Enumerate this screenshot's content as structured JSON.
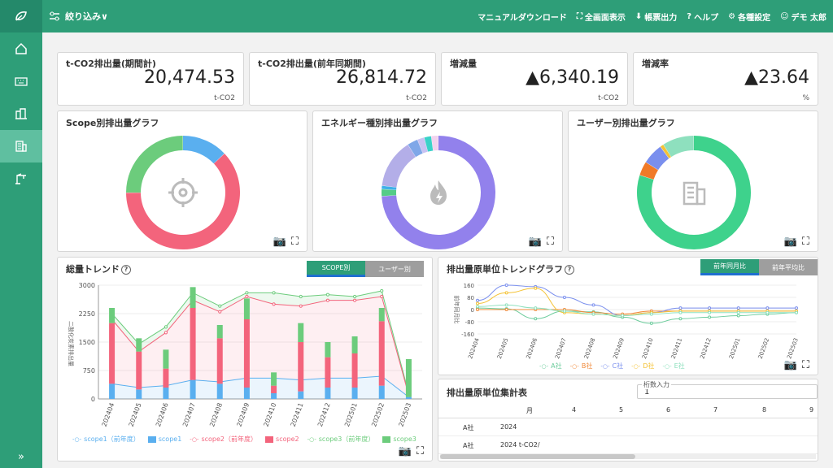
{
  "header": {
    "filter_label": "絞り込み∨",
    "items": [
      {
        "label": "マニュアルダウンロード",
        "icon": ""
      },
      {
        "label": "全画面表示",
        "icon": "⛶"
      },
      {
        "label": "帳票出力",
        "icon": "⬇"
      },
      {
        "label": "ヘルプ",
        "icon": "?"
      },
      {
        "label": "各種設定",
        "icon": "⚙"
      },
      {
        "label": "デモ 太郎",
        "icon": "☺"
      }
    ]
  },
  "kpis": [
    {
      "title": "t-CO2排出量(期間計)",
      "value": "20,474.53",
      "unit": "t-CO2"
    },
    {
      "title": "t-CO2排出量(前年同期間)",
      "value": "26,814.72",
      "unit": "t-CO2"
    },
    {
      "title": "増減量",
      "value": "▲6,340.19",
      "unit": "t-CO2"
    },
    {
      "title": "増減率",
      "value": "▲23.64",
      "unit": "%"
    }
  ],
  "donuts": [
    {
      "title": "Scope別排出量グラフ",
      "icon": "crosshair-icon"
    },
    {
      "title": "エネルギー種別排出量グラフ",
      "icon": "flame-icon"
    },
    {
      "title": "ユーザー別排出量グラフ",
      "icon": "building-icon"
    }
  ],
  "trend": {
    "title": "総量トレンド",
    "toggle_on": "SCOPE別",
    "toggle_off": "ユーザー別",
    "ylabel": "二酸化炭素排出量",
    "legend": [
      "scope1（前年度）",
      "scope1",
      "scope2（前年度）",
      "scope2",
      "scope3（前年度）",
      "scope3"
    ]
  },
  "intensity": {
    "title": "排出量原単位トレンドグラフ",
    "toggle_on": "前年同月比",
    "toggle_off": "前年平均比",
    "ylabel": "前年同月比",
    "legend": [
      "A社",
      "B社",
      "C社",
      "D社",
      "E社"
    ]
  },
  "table": {
    "title": "排出量原単位集計表",
    "input_label": "桁数入力",
    "input_value": "1",
    "headers": [
      "月",
      "4",
      "5",
      "6",
      "7",
      "8",
      "9"
    ],
    "rows": [
      {
        "company": "A社",
        "value": "2024"
      },
      {
        "company": "A社",
        "value": "2024  t-CO2/"
      }
    ]
  },
  "colors": {
    "brand": "#2e9e78",
    "scope1": "#5aafef",
    "scope2": "#f3647c",
    "scope3": "#6ccc7c",
    "energy": "#9281ec",
    "user": "#3ed28c"
  },
  "chart_data": [
    {
      "type": "pie",
      "title": "Scope別排出量グラフ",
      "series": [
        {
          "name": "scope1",
          "values": [
            0.13
          ]
        },
        {
          "name": "scope2",
          "values": [
            0.62
          ]
        },
        {
          "name": "scope3",
          "values": [
            0.25
          ]
        }
      ]
    },
    {
      "type": "pie",
      "title": "エネルギー種別排出量グラフ",
      "values": [
        0.74,
        0.02,
        0.01,
        0.14,
        0.03,
        0.02,
        0.02,
        0.02
      ]
    },
    {
      "type": "pie",
      "title": "ユーザー別排出量グラフ",
      "values": [
        0.8,
        0.04,
        0.06,
        0.01,
        0.09
      ]
    },
    {
      "type": "bar",
      "title": "総量トレンド",
      "categories": [
        "202404",
        "202405",
        "202406",
        "202407",
        "202408",
        "202409",
        "202410",
        "202411",
        "202412",
        "202501",
        "202502",
        "202503"
      ],
      "ylim": [
        0,
        3000
      ],
      "series": [
        {
          "name": "scope1",
          "values": [
            400,
            250,
            300,
            500,
            400,
            300,
            150,
            200,
            300,
            300,
            350,
            50
          ]
        },
        {
          "name": "scope2",
          "values": [
            1600,
            1000,
            500,
            1900,
            1200,
            1800,
            200,
            1300,
            800,
            900,
            1700,
            0
          ]
        },
        {
          "name": "scope3",
          "values": [
            400,
            350,
            500,
            550,
            350,
            550,
            350,
            500,
            400,
            450,
            350,
            1000
          ]
        },
        {
          "name": "scope1（前年度）",
          "values": [
            400,
            300,
            350,
            500,
            450,
            550,
            550,
            500,
            550,
            550,
            600,
            50
          ]
        },
        {
          "name": "scope2（前年度）",
          "values": [
            2100,
            1250,
            1750,
            2600,
            2300,
            2700,
            2500,
            2450,
            2600,
            2600,
            2700,
            100
          ]
        },
        {
          "name": "scope3（前年度）",
          "values": [
            2250,
            1450,
            1900,
            2800,
            2450,
            2800,
            2800,
            2700,
            2750,
            2700,
            2850,
            150
          ]
        }
      ]
    },
    {
      "type": "line",
      "title": "排出量原単位トレンドグラフ",
      "categories": [
        "202404",
        "202405",
        "202406",
        "202407",
        "202408",
        "202409",
        "202410",
        "202411",
        "202412",
        "202501",
        "202502",
        "202503"
      ],
      "ylim": [
        -160,
        160
      ],
      "series": [
        {
          "name": "A社",
          "values": [
            10,
            5,
            -60,
            -10,
            -15,
            -50,
            -90,
            -60,
            -50,
            -40,
            -30,
            -20
          ]
        },
        {
          "name": "B社",
          "values": [
            0,
            0,
            0,
            0,
            -20,
            -30,
            -10,
            -10,
            -10,
            -10,
            -10,
            -10
          ]
        },
        {
          "name": "C社",
          "values": [
            60,
            160,
            150,
            80,
            30,
            -40,
            -20,
            10,
            10,
            10,
            10,
            10
          ]
        },
        {
          "name": "D社",
          "values": [
            40,
            110,
            140,
            -20,
            -30,
            -40,
            -20,
            -10,
            -10,
            -10,
            -10,
            -10
          ]
        },
        {
          "name": "E社",
          "values": [
            20,
            30,
            10,
            -10,
            -30,
            -40,
            -30,
            -20,
            -20,
            -20,
            -20,
            -20
          ]
        }
      ]
    }
  ]
}
